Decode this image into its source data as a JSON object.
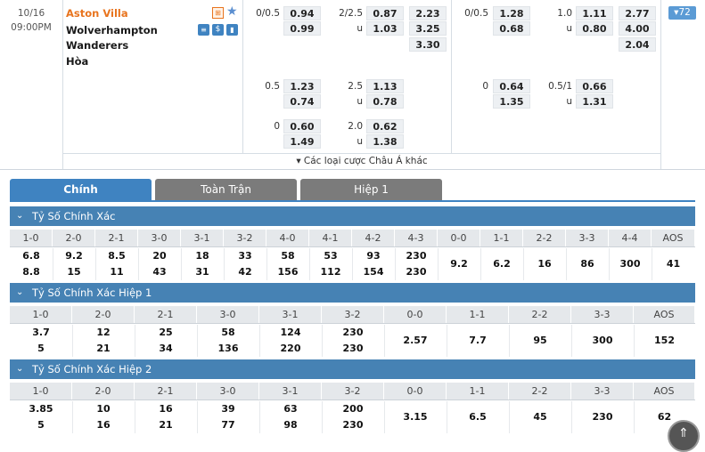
{
  "match": {
    "date": "10/16",
    "time": "09:00PM",
    "home": "Aston Villa",
    "away_line1": "Wolverhampton",
    "away_line2": "Wanderers",
    "draw": "Hòa",
    "count": "▾72"
  },
  "ft_hdp": [
    {
      "line": "0/0.5",
      "h": "0.94",
      "a": "0.99"
    },
    {
      "line": "0.5",
      "h": "1.23",
      "a": "0.74"
    },
    {
      "line": "0",
      "h": "0.60",
      "a": "1.49"
    }
  ],
  "ft_ou": [
    {
      "line": "2/2.5",
      "o": "0.87",
      "u_label": "u",
      "u": "1.03"
    },
    {
      "line": "2.5",
      "o": "1.13",
      "u_label": "u",
      "u": "0.78"
    },
    {
      "line": "2.0",
      "o": "0.62",
      "u_label": "u",
      "u": "1.38"
    }
  ],
  "ft_1x2": [
    "2.23",
    "3.25",
    "3.30"
  ],
  "h1_hdp": [
    {
      "line": "0/0.5",
      "h": "1.28",
      "a": "0.68"
    },
    {
      "line": "0",
      "h": "0.64",
      "a": "1.35"
    }
  ],
  "h1_ou": [
    {
      "line": "1.0",
      "o": "1.11",
      "u_label": "u",
      "u": "0.80"
    },
    {
      "line": "0.5/1",
      "o": "0.66",
      "u_label": "u",
      "u": "1.31"
    }
  ],
  "h1_1x2": [
    "2.77",
    "4.00",
    "2.04"
  ],
  "other_link": "▾ Các loại cược Châu Á khác",
  "tabs": [
    "Chính",
    "Toàn Trận",
    "Hiệp 1"
  ],
  "sections": [
    {
      "title": "Tỷ Số Chính Xác",
      "cols": [
        "1-0",
        "2-0",
        "2-1",
        "3-0",
        "3-1",
        "3-2",
        "4-0",
        "4-1",
        "4-2",
        "4-3",
        "0-0",
        "1-1",
        "2-2",
        "3-3",
        "4-4",
        "AOS"
      ],
      "top": [
        "6.8",
        "9.2",
        "8.5",
        "20",
        "18",
        "33",
        "58",
        "53",
        "93",
        "230"
      ],
      "bottom": [
        "8.8",
        "15",
        "11",
        "43",
        "31",
        "42",
        "156",
        "112",
        "154",
        "230"
      ],
      "single": [
        "9.2",
        "6.2",
        "16",
        "86",
        "300",
        "41"
      ]
    },
    {
      "title": "Tỷ Số Chính Xác Hiệp 1",
      "cols": [
        "1-0",
        "2-0",
        "2-1",
        "3-0",
        "3-1",
        "3-2",
        "0-0",
        "1-1",
        "2-2",
        "3-3",
        "AOS"
      ],
      "top": [
        "3.7",
        "12",
        "25",
        "58",
        "124",
        "230"
      ],
      "bottom": [
        "5",
        "21",
        "34",
        "136",
        "220",
        "230"
      ],
      "single": [
        "2.57",
        "7.7",
        "95",
        "300",
        "152"
      ]
    },
    {
      "title": "Tỷ Số Chính Xác Hiệp 2",
      "cols": [
        "1-0",
        "2-0",
        "2-1",
        "3-0",
        "3-1",
        "3-2",
        "0-0",
        "1-1",
        "2-2",
        "3-3",
        "AOS"
      ],
      "top": [
        "3.85",
        "10",
        "16",
        "39",
        "63",
        "200"
      ],
      "bottom": [
        "5",
        "16",
        "21",
        "77",
        "98",
        "230"
      ],
      "single": [
        "3.15",
        "6.5",
        "45",
        "230",
        "62"
      ]
    }
  ],
  "colors": {
    "accent": "#4682b4",
    "tab_active": "#3f83c1",
    "tab_inactive": "#7b7b7b",
    "home_team": "#e8741e"
  }
}
